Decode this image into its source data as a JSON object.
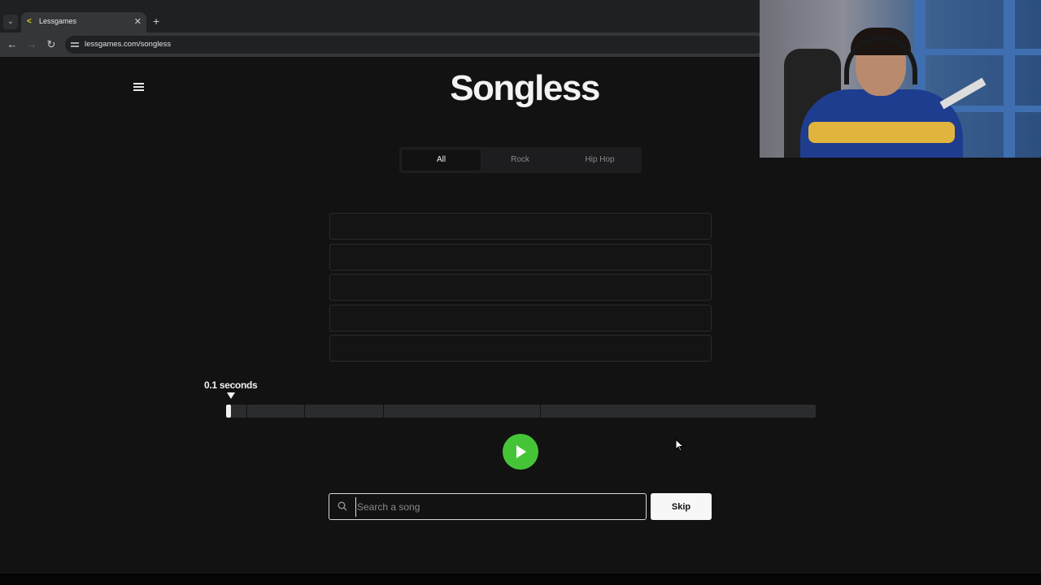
{
  "browser": {
    "tab_title": "Lessgames",
    "url": "lessgames.com/songless",
    "new_tab_symbol": "+",
    "close_symbol": "✕"
  },
  "app": {
    "title": "Songless",
    "genres": [
      {
        "label": "All",
        "active": true
      },
      {
        "label": "Rock",
        "active": false
      },
      {
        "label": "Hip Hop",
        "active": false
      }
    ],
    "guess_rows": [
      "",
      "",
      "",
      "",
      ""
    ],
    "clip_length_label": "0.1 seconds",
    "clip_progress": 0.008,
    "search_placeholder": "Search a song",
    "search_value": "",
    "skip_label": "Skip",
    "play_color": "#46c437"
  }
}
